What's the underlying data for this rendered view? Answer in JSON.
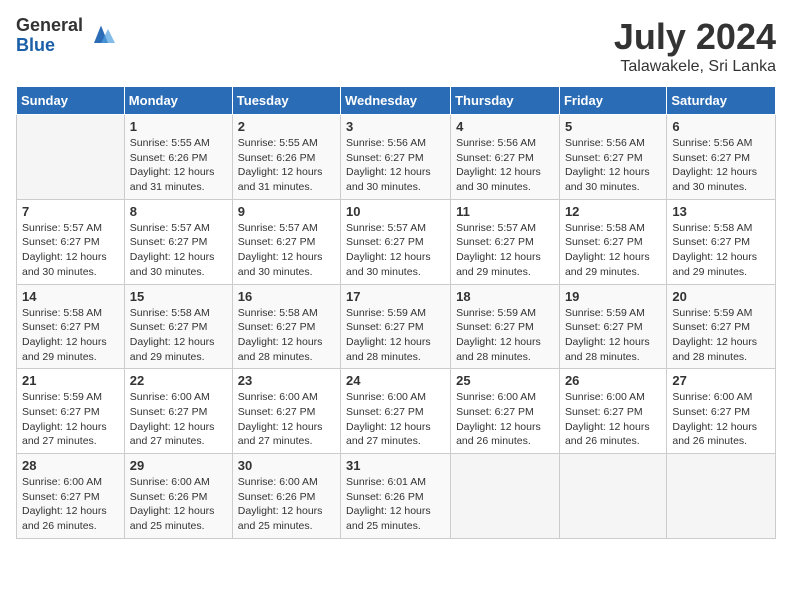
{
  "header": {
    "logo_general": "General",
    "logo_blue": "Blue",
    "title": "July 2024",
    "subtitle": "Talawakele, Sri Lanka"
  },
  "days_of_week": [
    "Sunday",
    "Monday",
    "Tuesday",
    "Wednesday",
    "Thursday",
    "Friday",
    "Saturday"
  ],
  "weeks": [
    [
      {
        "day": "",
        "info": ""
      },
      {
        "day": "1",
        "info": "Sunrise: 5:55 AM\nSunset: 6:26 PM\nDaylight: 12 hours\nand 31 minutes."
      },
      {
        "day": "2",
        "info": "Sunrise: 5:55 AM\nSunset: 6:26 PM\nDaylight: 12 hours\nand 31 minutes."
      },
      {
        "day": "3",
        "info": "Sunrise: 5:56 AM\nSunset: 6:27 PM\nDaylight: 12 hours\nand 30 minutes."
      },
      {
        "day": "4",
        "info": "Sunrise: 5:56 AM\nSunset: 6:27 PM\nDaylight: 12 hours\nand 30 minutes."
      },
      {
        "day": "5",
        "info": "Sunrise: 5:56 AM\nSunset: 6:27 PM\nDaylight: 12 hours\nand 30 minutes."
      },
      {
        "day": "6",
        "info": "Sunrise: 5:56 AM\nSunset: 6:27 PM\nDaylight: 12 hours\nand 30 minutes."
      }
    ],
    [
      {
        "day": "7",
        "info": "Sunrise: 5:57 AM\nSunset: 6:27 PM\nDaylight: 12 hours\nand 30 minutes."
      },
      {
        "day": "8",
        "info": "Sunrise: 5:57 AM\nSunset: 6:27 PM\nDaylight: 12 hours\nand 30 minutes."
      },
      {
        "day": "9",
        "info": "Sunrise: 5:57 AM\nSunset: 6:27 PM\nDaylight: 12 hours\nand 30 minutes."
      },
      {
        "day": "10",
        "info": "Sunrise: 5:57 AM\nSunset: 6:27 PM\nDaylight: 12 hours\nand 30 minutes."
      },
      {
        "day": "11",
        "info": "Sunrise: 5:57 AM\nSunset: 6:27 PM\nDaylight: 12 hours\nand 29 minutes."
      },
      {
        "day": "12",
        "info": "Sunrise: 5:58 AM\nSunset: 6:27 PM\nDaylight: 12 hours\nand 29 minutes."
      },
      {
        "day": "13",
        "info": "Sunrise: 5:58 AM\nSunset: 6:27 PM\nDaylight: 12 hours\nand 29 minutes."
      }
    ],
    [
      {
        "day": "14",
        "info": "Sunrise: 5:58 AM\nSunset: 6:27 PM\nDaylight: 12 hours\nand 29 minutes."
      },
      {
        "day": "15",
        "info": "Sunrise: 5:58 AM\nSunset: 6:27 PM\nDaylight: 12 hours\nand 29 minutes."
      },
      {
        "day": "16",
        "info": "Sunrise: 5:58 AM\nSunset: 6:27 PM\nDaylight: 12 hours\nand 28 minutes."
      },
      {
        "day": "17",
        "info": "Sunrise: 5:59 AM\nSunset: 6:27 PM\nDaylight: 12 hours\nand 28 minutes."
      },
      {
        "day": "18",
        "info": "Sunrise: 5:59 AM\nSunset: 6:27 PM\nDaylight: 12 hours\nand 28 minutes."
      },
      {
        "day": "19",
        "info": "Sunrise: 5:59 AM\nSunset: 6:27 PM\nDaylight: 12 hours\nand 28 minutes."
      },
      {
        "day": "20",
        "info": "Sunrise: 5:59 AM\nSunset: 6:27 PM\nDaylight: 12 hours\nand 28 minutes."
      }
    ],
    [
      {
        "day": "21",
        "info": "Sunrise: 5:59 AM\nSunset: 6:27 PM\nDaylight: 12 hours\nand 27 minutes."
      },
      {
        "day": "22",
        "info": "Sunrise: 6:00 AM\nSunset: 6:27 PM\nDaylight: 12 hours\nand 27 minutes."
      },
      {
        "day": "23",
        "info": "Sunrise: 6:00 AM\nSunset: 6:27 PM\nDaylight: 12 hours\nand 27 minutes."
      },
      {
        "day": "24",
        "info": "Sunrise: 6:00 AM\nSunset: 6:27 PM\nDaylight: 12 hours\nand 27 minutes."
      },
      {
        "day": "25",
        "info": "Sunrise: 6:00 AM\nSunset: 6:27 PM\nDaylight: 12 hours\nand 26 minutes."
      },
      {
        "day": "26",
        "info": "Sunrise: 6:00 AM\nSunset: 6:27 PM\nDaylight: 12 hours\nand 26 minutes."
      },
      {
        "day": "27",
        "info": "Sunrise: 6:00 AM\nSunset: 6:27 PM\nDaylight: 12 hours\nand 26 minutes."
      }
    ],
    [
      {
        "day": "28",
        "info": "Sunrise: 6:00 AM\nSunset: 6:27 PM\nDaylight: 12 hours\nand 26 minutes."
      },
      {
        "day": "29",
        "info": "Sunrise: 6:00 AM\nSunset: 6:26 PM\nDaylight: 12 hours\nand 25 minutes."
      },
      {
        "day": "30",
        "info": "Sunrise: 6:00 AM\nSunset: 6:26 PM\nDaylight: 12 hours\nand 25 minutes."
      },
      {
        "day": "31",
        "info": "Sunrise: 6:01 AM\nSunset: 6:26 PM\nDaylight: 12 hours\nand 25 minutes."
      },
      {
        "day": "",
        "info": ""
      },
      {
        "day": "",
        "info": ""
      },
      {
        "day": "",
        "info": ""
      }
    ]
  ]
}
